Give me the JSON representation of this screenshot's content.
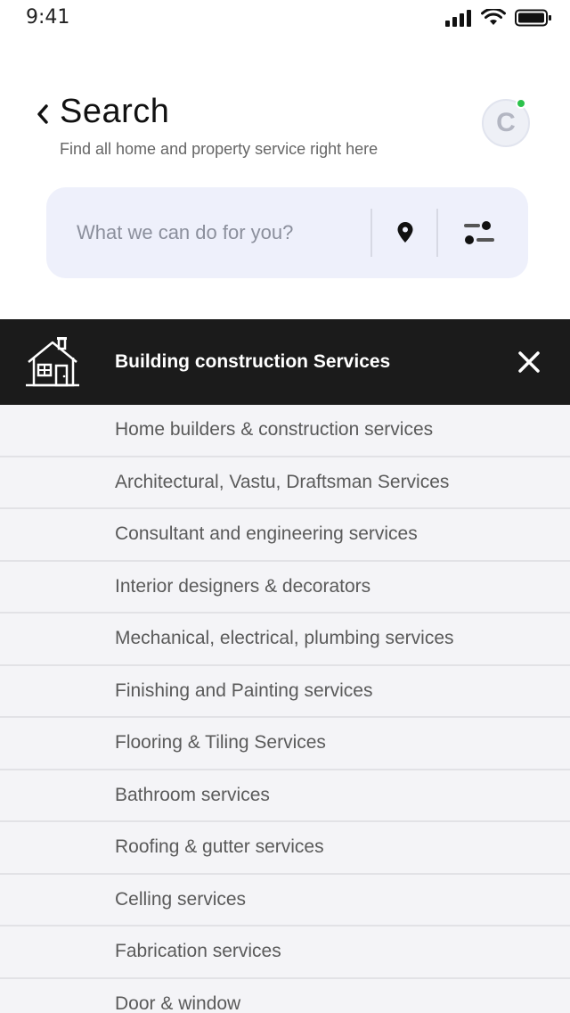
{
  "status_bar": {
    "time": "9:41"
  },
  "header": {
    "title": "Search",
    "subtitle": "Find all home and property service right here",
    "avatar_initial": "C",
    "online_color": "#2bc24b"
  },
  "search": {
    "placeholder": "What we can do for you?",
    "value": ""
  },
  "category": {
    "title": "Building construction Services",
    "icon": "house-icon"
  },
  "services": [
    "Home builders & construction services",
    "Architectural, Vastu, Draftsman Services",
    "Consultant and engineering services",
    "Interior designers & decorators",
    "Mechanical, electrical, plumbing services",
    "Finishing and Painting services",
    "Flooring & Tiling Services",
    "Bathroom services",
    "Roofing & gutter services",
    "Celling services",
    "Fabrication services",
    "Door & window"
  ]
}
